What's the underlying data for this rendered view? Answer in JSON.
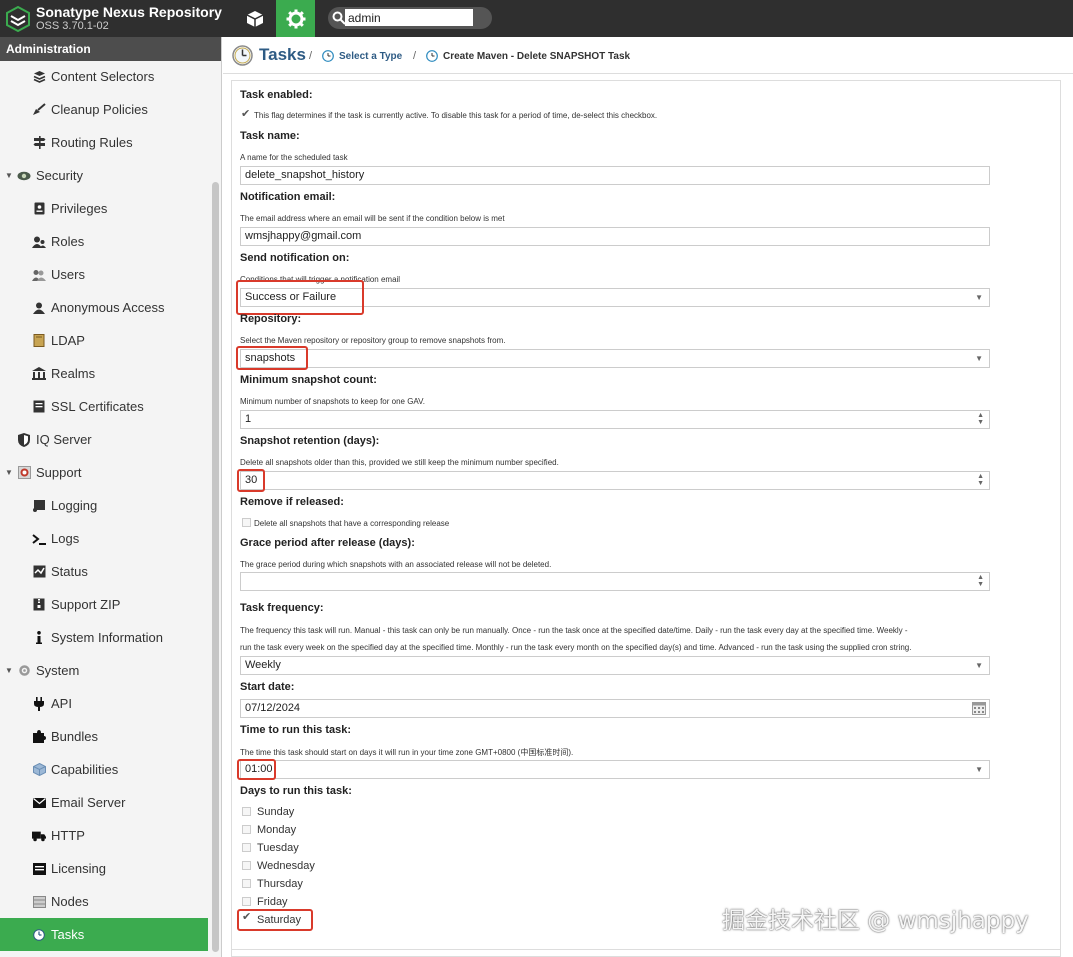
{
  "app": {
    "title": "Sonatype Nexus Repository",
    "version": "OSS 3.70.1-02",
    "search_value": "admin"
  },
  "sidebar": {
    "header": "Administration",
    "items": [
      {
        "label": "Content Selectors",
        "icon": "layers-icon"
      },
      {
        "label": "Cleanup Policies",
        "icon": "broom-icon"
      },
      {
        "label": "Routing Rules",
        "icon": "signpost-icon"
      },
      {
        "label": "Security",
        "icon": "eye-icon",
        "group": true
      },
      {
        "label": "Privileges",
        "icon": "badge-icon"
      },
      {
        "label": "Roles",
        "icon": "users-icon"
      },
      {
        "label": "Users",
        "icon": "user-group-icon"
      },
      {
        "label": "Anonymous Access",
        "icon": "user-icon"
      },
      {
        "label": "LDAP",
        "icon": "book-icon"
      },
      {
        "label": "Realms",
        "icon": "realm-icon"
      },
      {
        "label": "SSL Certificates",
        "icon": "certificate-icon"
      },
      {
        "label": "IQ Server",
        "icon": "shield-icon"
      },
      {
        "label": "Support",
        "icon": "lifebuoy-icon",
        "group": true
      },
      {
        "label": "Logging",
        "icon": "scroll-icon"
      },
      {
        "label": "Logs",
        "icon": "terminal-icon"
      },
      {
        "label": "Status",
        "icon": "status-icon"
      },
      {
        "label": "Support ZIP",
        "icon": "zip-icon"
      },
      {
        "label": "System Information",
        "icon": "info-icon"
      },
      {
        "label": "System",
        "icon": "gear-icon",
        "group": true
      },
      {
        "label": "API",
        "icon": "plug-icon"
      },
      {
        "label": "Bundles",
        "icon": "puzzle-icon"
      },
      {
        "label": "Capabilities",
        "icon": "cube-icon"
      },
      {
        "label": "Email Server",
        "icon": "envelope-icon"
      },
      {
        "label": "HTTP",
        "icon": "truck-icon"
      },
      {
        "label": "Licensing",
        "icon": "license-icon"
      },
      {
        "label": "Nodes",
        "icon": "server-icon"
      },
      {
        "label": "Tasks",
        "icon": "clock-icon",
        "selected": true
      }
    ]
  },
  "breadcrumb": {
    "title": "Tasks",
    "select_type": "Select a Type",
    "current": "Create Maven - Delete SNAPSHOT Task",
    "sep": "/"
  },
  "form": {
    "task_enabled": {
      "label": "Task enabled:",
      "help": "This flag determines if the task is currently active. To disable this task for a period of time, de-select this checkbox.",
      "checked": true
    },
    "task_name": {
      "label": "Task name:",
      "help": "A name for the scheduled task",
      "value": "delete_snapshot_history"
    },
    "notification_email": {
      "label": "Notification email:",
      "help": "The email address where an email will be sent if the condition below is met",
      "value": "wmsjhappy@gmail.com"
    },
    "send_notification": {
      "label": "Send notification on:",
      "help": "Conditions that will trigger a notification email",
      "value": "Success or Failure"
    },
    "repository": {
      "label": "Repository:",
      "help": "Select the Maven repository or repository group to remove snapshots from.",
      "value": "snapshots"
    },
    "min_snapshot": {
      "label": "Minimum snapshot count:",
      "help": "Minimum number of snapshots to keep for one GAV.",
      "value": "1"
    },
    "retention": {
      "label": "Snapshot retention (days):",
      "help": "Delete all snapshots older than this, provided we still keep the minimum number specified.",
      "value": "30"
    },
    "remove_released": {
      "label": "Remove if released:",
      "help": "Delete all snapshots that have a corresponding release",
      "checked": false
    },
    "grace_period": {
      "label": "Grace period after release (days):",
      "help": "The grace period during which snapshots with an associated release will not be deleted.",
      "value": ""
    },
    "frequency": {
      "label": "Task frequency:",
      "help_line1": "The frequency this task will run. Manual - this task can only be run manually. Once - run the task once at the specified date/time. Daily - run the task every day at the specified time. Weekly -",
      "help_line2": "run the task every week on the specified day at the specified time. Monthly - run the task every month on the specified day(s) and time. Advanced - run the task using the supplied cron string.",
      "value": "Weekly"
    },
    "start_date": {
      "label": "Start date:",
      "value": "07/12/2024"
    },
    "time_to_run": {
      "label": "Time to run this task:",
      "help": "The time this task should start on days it will run in your time zone GMT+0800 (中国标准时间).",
      "value": "01:00"
    },
    "days": {
      "label": "Days to run this task:",
      "items": [
        {
          "label": "Sunday",
          "checked": false
        },
        {
          "label": "Monday",
          "checked": false
        },
        {
          "label": "Tuesday",
          "checked": false
        },
        {
          "label": "Wednesday",
          "checked": false
        },
        {
          "label": "Thursday",
          "checked": false
        },
        {
          "label": "Friday",
          "checked": false
        },
        {
          "label": "Saturday",
          "checked": true
        }
      ]
    }
  },
  "watermark": "掘金技术社区 @ wmsjhappy",
  "colors": {
    "accent": "#3bab4f",
    "highlight": "#d93a2b",
    "topbar": "#2f2f2f",
    "link": "#2e5b84"
  }
}
